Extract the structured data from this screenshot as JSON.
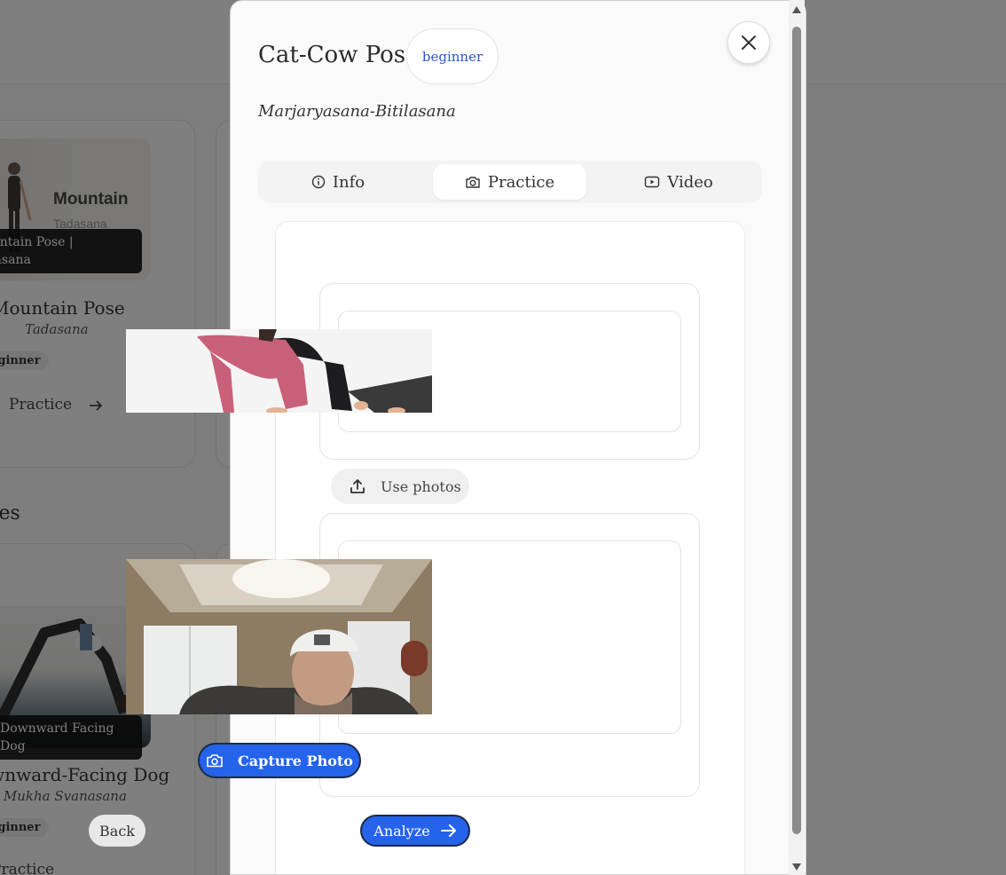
{
  "background": {
    "cards": [
      {
        "thumb_title": "Mountain",
        "thumb_subtitle": "Tadasana",
        "thumb_caption": "Mountain Pose | Tadasana",
        "title": "Mountain Pose",
        "sanskrit": "Tadasana",
        "badge": "beginner",
        "practice_label": "Practice"
      },
      {
        "thumb_caption": "Downward Facing Dog",
        "title": "Downward-Facing Dog",
        "sanskrit": "Adho Mukha Svanasana",
        "badge": "beginner",
        "practice_label": "Practice"
      }
    ],
    "section_title": "Poses"
  },
  "modal": {
    "title": "Cat-Cow Pose",
    "level": "beginner",
    "sanskrit": "Marjaryasana-Bitilasana",
    "tabs": [
      {
        "label": "Info",
        "icon": "info-icon"
      },
      {
        "label": "Practice",
        "icon": "camera-icon",
        "active": true
      },
      {
        "label": "Video",
        "icon": "video-icon"
      }
    ],
    "reference_photo": {
      "alt": "Cat-Cow reference pose"
    },
    "use_photos_label": "Use photos",
    "webcam_feed": {
      "alt": "Live webcam preview"
    },
    "capture_label": "Capture Photo",
    "back_label": "Back",
    "analyze_label": "Analyze"
  },
  "colors": {
    "accent": "#2563eb",
    "badge_text": "#2f55c4",
    "overlay": "rgba(0,0,0,0.5)"
  }
}
